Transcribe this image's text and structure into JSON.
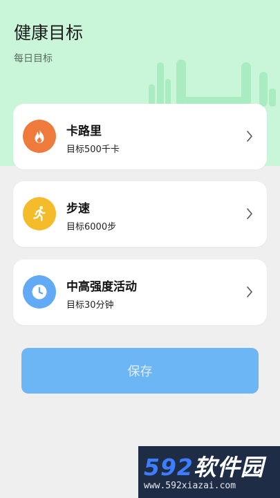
{
  "header": {
    "title": "健康目标",
    "subtitle": "每日目标"
  },
  "goals": [
    {
      "name": "卡路里",
      "target": "目标500千卡",
      "icon": "flame-icon",
      "color": "#ee7a3c"
    },
    {
      "name": "步速",
      "target": "目标6000步",
      "icon": "running-person-icon",
      "color": "#f4bb2a"
    },
    {
      "name": "中高强度活动",
      "target": "目标30分钟",
      "icon": "clock-icon",
      "color": "#62aaf4"
    }
  ],
  "save_label": "保存",
  "watermark": {
    "brand_number": "592",
    "brand_text": "软件园",
    "url": "www.592xiazai.com"
  },
  "colors": {
    "header_bg": "#c9f6d9",
    "page_bg": "#efefef",
    "save_button": "#6cb6f6"
  }
}
